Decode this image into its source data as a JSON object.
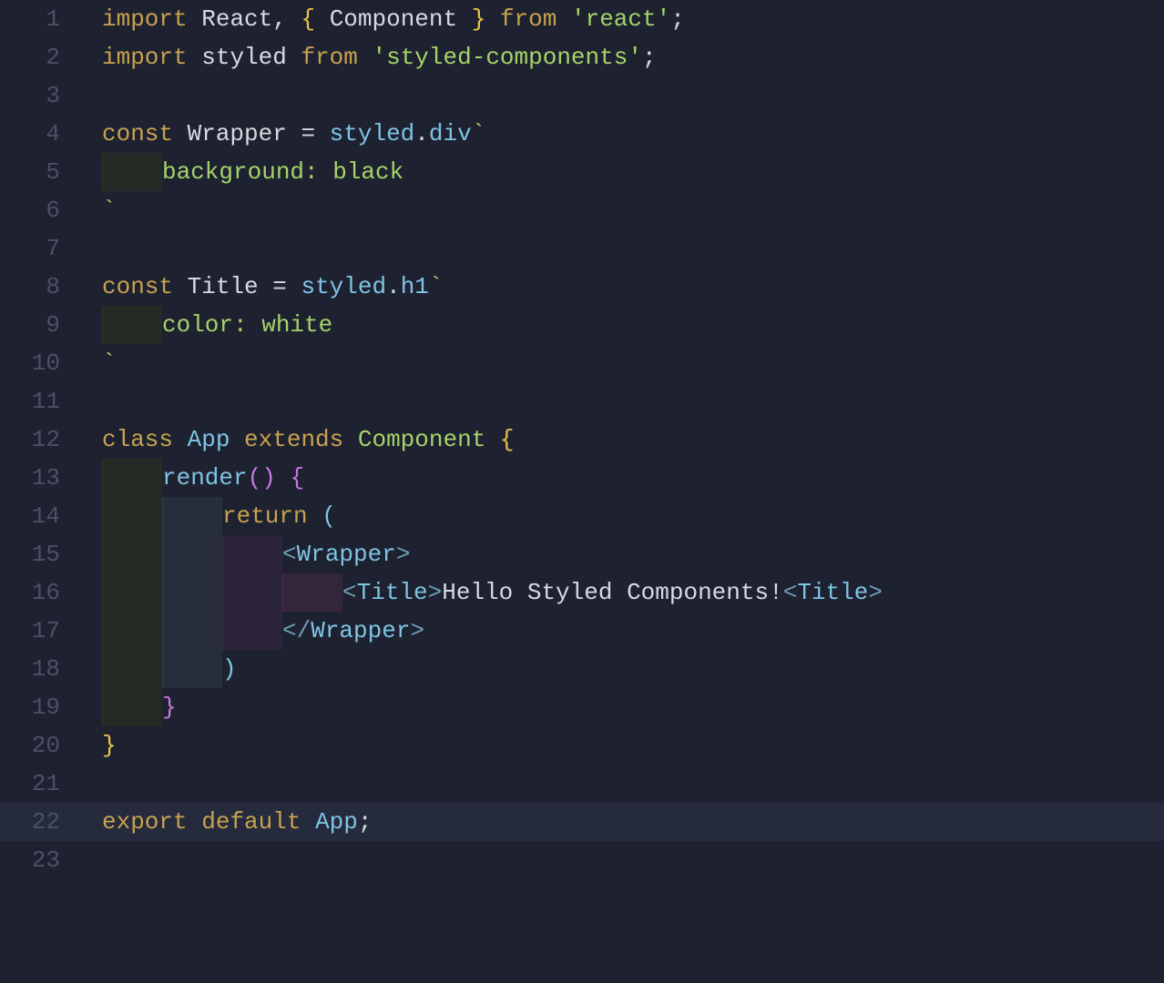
{
  "colors": {
    "background": "#1e2130",
    "gutter": "#4a5067",
    "highlighted_line_bg": "#252a3d",
    "keyword": "#c8a24f",
    "string": "#a5d46a",
    "identifier_blue": "#7fc4e4",
    "brace_yellow": "#e6c547",
    "paren_magenta": "#c678dd",
    "text_default": "#d7dbe0",
    "tag_bracket": "#6fa0b8"
  },
  "editor": {
    "highlighted_line": 22,
    "line_numbers": [
      "1",
      "2",
      "3",
      "4",
      "5",
      "6",
      "7",
      "8",
      "9",
      "10",
      "11",
      "12",
      "13",
      "14",
      "15",
      "16",
      "17",
      "18",
      "19",
      "20",
      "21",
      "22",
      "23"
    ]
  },
  "code": {
    "l1": {
      "import": "import",
      "react": "React",
      "comma": ", ",
      "lbrace": "{",
      "component": "Component",
      "rbrace": "}",
      "from": "from",
      "str": "'react'",
      "semi": ";"
    },
    "l2": {
      "import": "import",
      "styled": "styled",
      "from": "from",
      "str": "'styled-components'",
      "semi": ";"
    },
    "l3": {
      "blank": ""
    },
    "l4": {
      "const": "const",
      "wrapper": "Wrapper",
      "eq": "=",
      "styled": "styled",
      "dot": ".",
      "div": "div",
      "bt": "`"
    },
    "l5": {
      "css": "background: black"
    },
    "l6": {
      "bt": "`"
    },
    "l7": {
      "blank": ""
    },
    "l8": {
      "const": "const",
      "title": "Title",
      "eq": "=",
      "styled": "styled",
      "dot": ".",
      "h1": "h1",
      "bt": "`"
    },
    "l9": {
      "css": "color: white"
    },
    "l10": {
      "bt": "`"
    },
    "l11": {
      "blank": ""
    },
    "l12": {
      "class": "class",
      "app": "App",
      "extends": "extends",
      "component": "Component",
      "lbrace": "{"
    },
    "l13": {
      "render": "render",
      "lp": "(",
      "rp": ")",
      "lbrace": "{"
    },
    "l14": {
      "return": "return",
      "lp": "("
    },
    "l15": {
      "lt": "<",
      "tag": "Wrapper",
      "gt": ">"
    },
    "l16": {
      "lt1": "<",
      "tag1": "Title",
      "gt1": ">",
      "text": "Hello Styled Components!",
      "lt2": "<",
      "tag2": "Title",
      "gt2": ">"
    },
    "l17": {
      "lt": "<",
      "slash": "/",
      "tag": "Wrapper",
      "gt": ">"
    },
    "l18": {
      "rp": ")"
    },
    "l19": {
      "rbrace": "}"
    },
    "l20": {
      "rbrace": "}"
    },
    "l21": {
      "blank": ""
    },
    "l22": {
      "export": "export",
      "default": "default",
      "app": "App",
      "semi": ";"
    },
    "l23": {
      "blank": ""
    }
  }
}
